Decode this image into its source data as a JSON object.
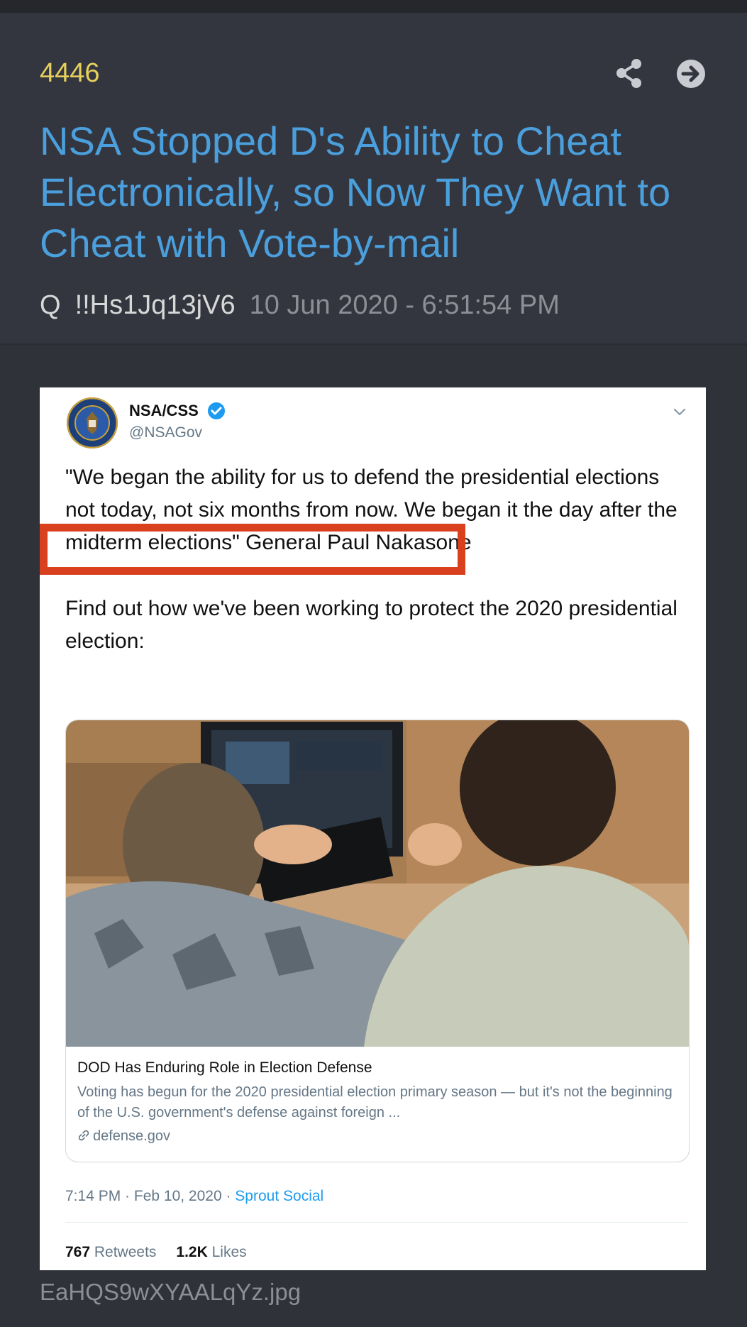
{
  "post": {
    "number": "4446",
    "title": "NSA Stopped D's Ability to Cheat Electronically, so Now They Want to Cheat with Vote-by-mail",
    "author": "Q",
    "tripcode": "!!Hs1Jq13jV6",
    "timestamp": "10 Jun 2020 - 6:51:54 PM"
  },
  "actions": {
    "share_icon": "share-icon",
    "next_icon": "arrow-right-circle-icon"
  },
  "tweet": {
    "account_name": "NSA/CSS",
    "handle": "@NSAGov",
    "paragraph1": "\"We began the ability for us to defend the presidential elections not today, not six months from now. We began it the day after the midterm elections\"  General Paul Nakasone",
    "paragraph2": "Find out how we've been working to protect the 2020 presidential election:",
    "link_card": {
      "title": "DOD Has Enduring Role in Election Defense",
      "description": "Voting has begun for the 2020 presidential election primary season — but it's not the beginning of the U.S. government's defense against foreign ...",
      "domain": "defense.gov"
    },
    "time": "7:14 PM · Feb 10, 2020 · ",
    "source": "Sprout Social",
    "retweets_count": "767",
    "retweets_label": " Retweets",
    "likes_count": "1.2K",
    "likes_label": " Likes",
    "highlight_color": "#d8401e",
    "verified_color": "#1d9bf0"
  },
  "attachment": {
    "filename": "EaHQS9wXYAALqYz.jpg"
  },
  "colors": {
    "background": "#2f3239",
    "post_number": "#e6cf5c",
    "title_link": "#4a9fdc",
    "muted": "#8c8f96"
  }
}
